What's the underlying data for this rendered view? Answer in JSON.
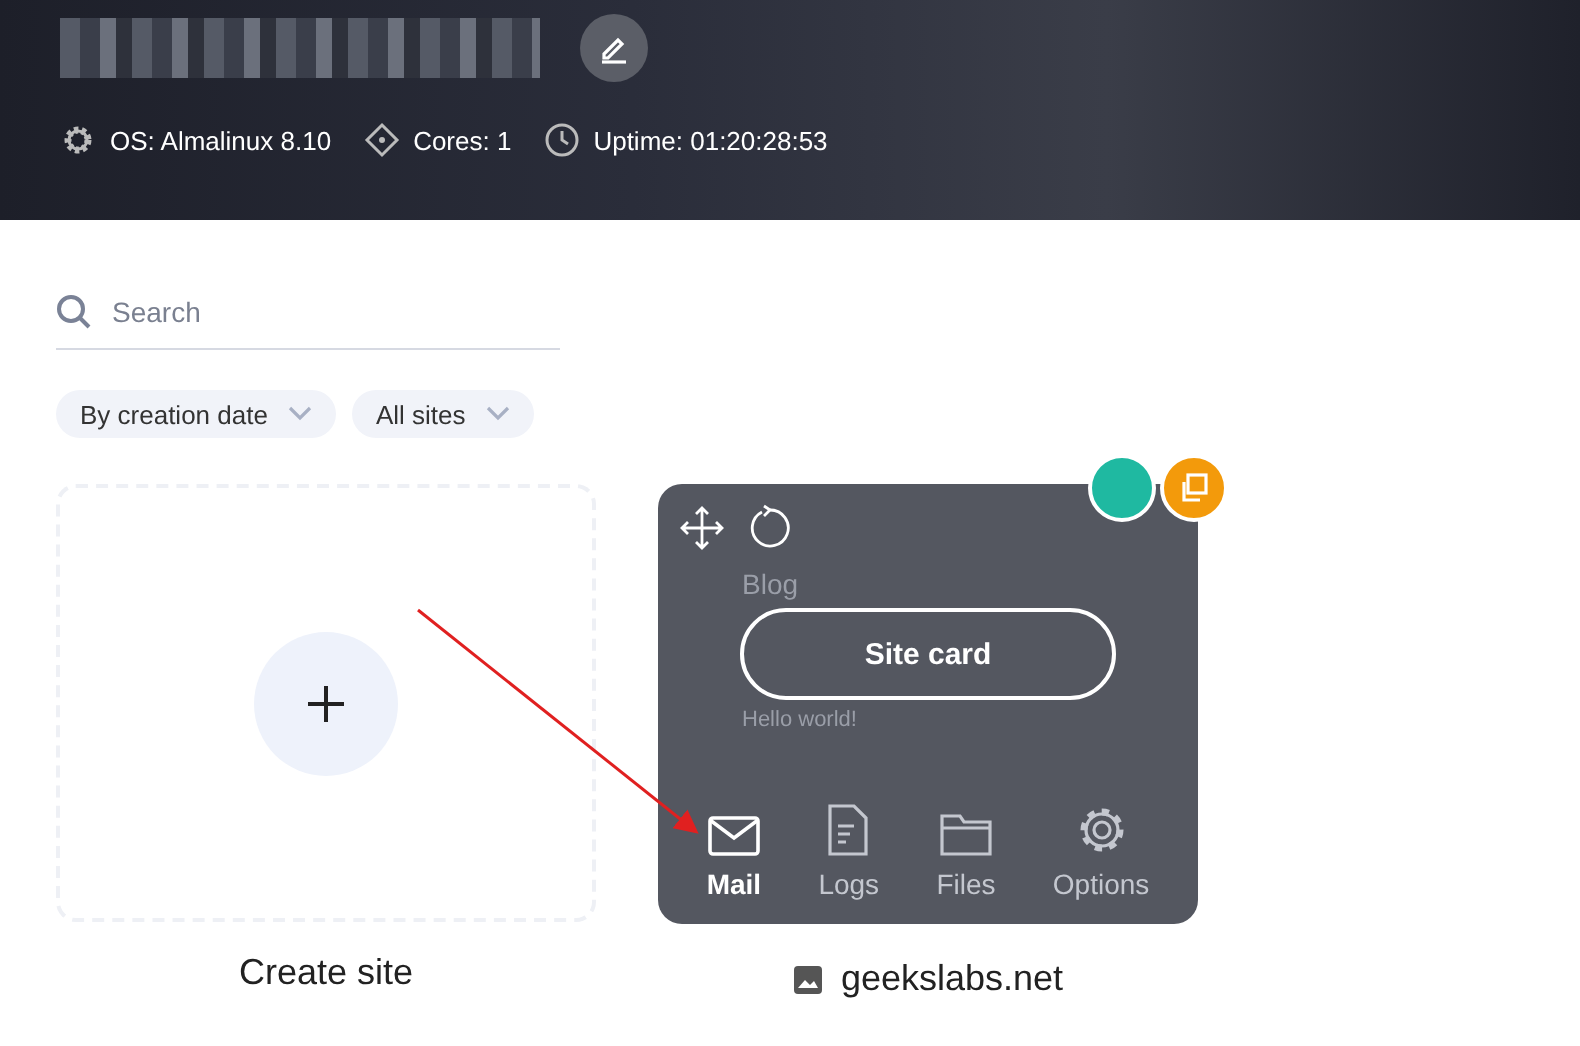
{
  "server": {
    "os": "OS: Almalinux 8.10",
    "cores": "Cores: 1",
    "uptime": "Uptime: 01:20:28:53"
  },
  "search": {
    "placeholder": "Search"
  },
  "filters": [
    {
      "label": "By creation date"
    },
    {
      "label": "All sites"
    }
  ],
  "create_site": {
    "label": "Create site"
  },
  "site": {
    "name": "geekslabs.net",
    "preview_title": "Blog",
    "preview_post": "Hello world!",
    "card_button": "Site card",
    "actions": [
      {
        "kind": "mail",
        "label": "Mail",
        "selected": true
      },
      {
        "kind": "logs",
        "label": "Logs",
        "selected": false
      },
      {
        "kind": "files",
        "label": "Files",
        "selected": false
      },
      {
        "kind": "options",
        "label": "Options",
        "selected": false
      }
    ]
  }
}
